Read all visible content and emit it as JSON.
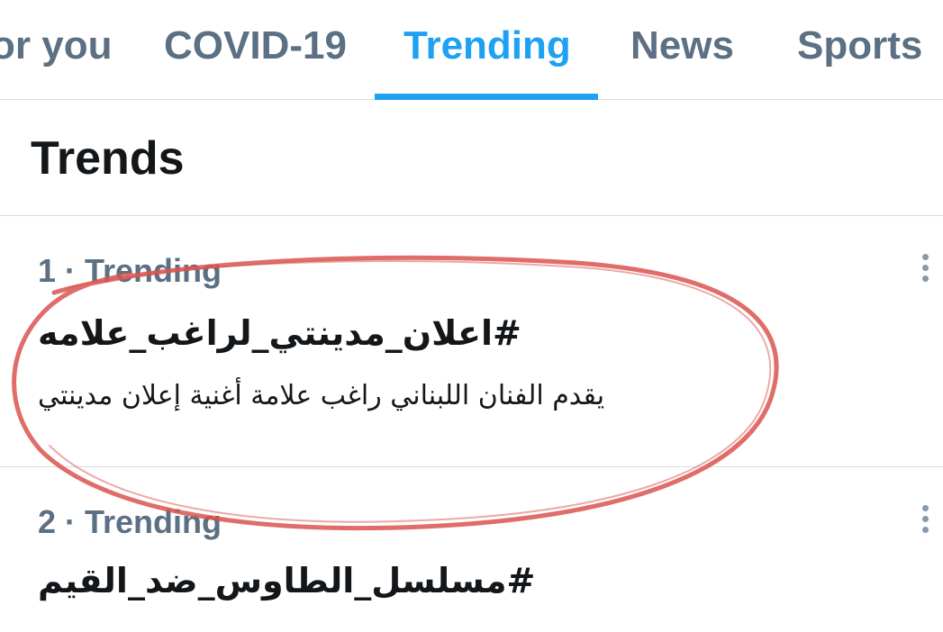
{
  "tabs": [
    {
      "label": "or you",
      "active": false
    },
    {
      "label": "COVID-19",
      "active": false
    },
    {
      "label": "Trending",
      "active": true
    },
    {
      "label": "News",
      "active": false
    },
    {
      "label": "Sports",
      "active": false
    }
  ],
  "section": {
    "title": "Trends"
  },
  "trends": [
    {
      "meta": "1 · Trending",
      "name": "#اعلان_مدينتي_لراغب_علامه",
      "description": "يقدم الفنان اللبناني راغب علامة أغنية إعلان مدينتي",
      "more_icon": "more-vertical-icon"
    },
    {
      "meta": "2 · Trending",
      "name": "#مسلسل_الطاوس_ضد_القيم",
      "more_icon": "more-vertical-icon"
    }
  ],
  "colors": {
    "accent": "#1da1f2",
    "tab_inactive": "#5b7083",
    "text": "#14171a",
    "divider": "#d9dde1",
    "annotation": "#d9534f"
  }
}
